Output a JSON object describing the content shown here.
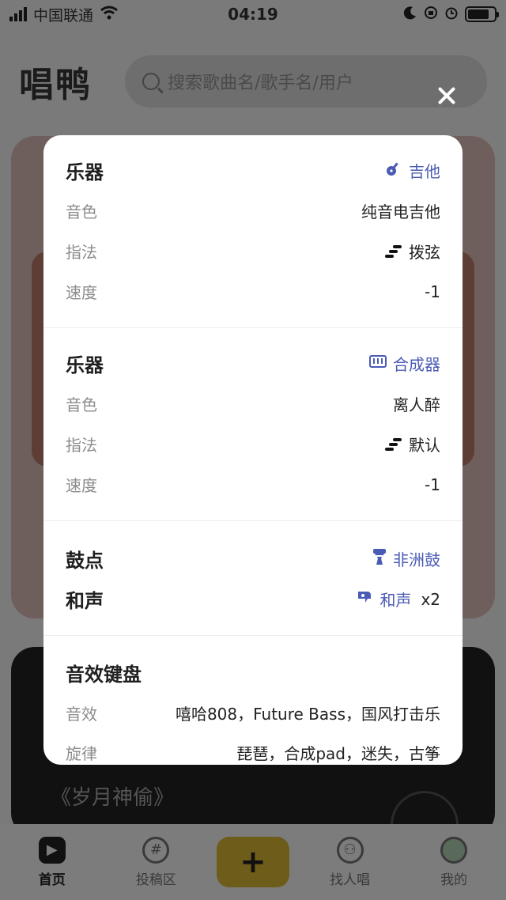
{
  "status": {
    "carrier": "中国联通",
    "time": "04:19"
  },
  "header": {
    "logo": "唱鸭",
    "search_placeholder": "搜索歌曲名/歌手名/用户"
  },
  "background": {
    "song_title": "《岁月神偷》"
  },
  "modal": {
    "instrument1": {
      "heading": "乐器",
      "instrument": "吉他",
      "tone_label": "音色",
      "tone_value": "纯音电吉他",
      "fingering_label": "指法",
      "fingering_value": "拨弦",
      "speed_label": "速度",
      "speed_value": "-1"
    },
    "instrument2": {
      "heading": "乐器",
      "instrument": "合成器",
      "tone_label": "音色",
      "tone_value": "离人醉",
      "fingering_label": "指法",
      "fingering_value": "默认",
      "speed_label": "速度",
      "speed_value": "-1"
    },
    "drums": {
      "label": "鼓点",
      "value": "非洲鼓"
    },
    "harmony": {
      "label": "和声",
      "value": "和声",
      "multiplier": "x2"
    },
    "fx_keyboard": {
      "heading": "音效键盘",
      "effects_label": "音效",
      "effects_value": "嘻哈808，Future Bass，国风打击乐",
      "melody_label": "旋律",
      "melody_value": "琵琶，合成pad，迷失，古筝"
    }
  },
  "tabbar": {
    "home": "首页",
    "submit": "投稿区",
    "plus": "+",
    "find": "找人唱",
    "me": "我的"
  },
  "colors": {
    "accent": "#4a5bb5",
    "overlay": "#7a7a7a"
  }
}
